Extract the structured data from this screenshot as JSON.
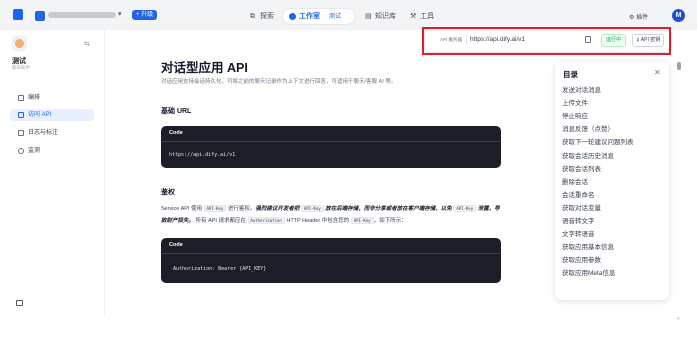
{
  "topbar": {
    "workspace_badge": "+ 升级",
    "nav": [
      {
        "label": "探索"
      },
      {
        "label": "工作室",
        "app": "测试"
      },
      {
        "label": "知识库"
      },
      {
        "label": "工具"
      }
    ],
    "plugins_label": "插件",
    "user_initial": "M"
  },
  "sidebar": {
    "app_name": "测试",
    "app_type": "聊天助手",
    "items": [
      {
        "label": "编排",
        "icon": "orchestrate-icon"
      },
      {
        "label": "访问 API",
        "icon": "api-icon",
        "active": true
      },
      {
        "label": "日志与标注",
        "icon": "logs-icon"
      },
      {
        "label": "监测",
        "icon": "monitor-icon"
      }
    ]
  },
  "main": {
    "title": "对话型应用 API",
    "description": "对话应用支持会话持久化，可将之前的聊天记录作为上下文进行回答，可适用于聊天/客服 AI 等。",
    "base_url_heading": "基础 URL",
    "code1_header": "Code",
    "code1_body": "https://api.dify.ai/v1",
    "auth_heading": "鉴权",
    "auth": {
      "t1": "Service API 使用 ",
      "c1": "API-Key",
      "t2": " 进行鉴权。",
      "b1": "强烈建议开发者把 ",
      "c2": "API-Key",
      "b2": " 放在后端存储，而非分享或者放在客户端存储，以免 ",
      "c3": "API-Key",
      "b3": " 泄露，导致财产损失。",
      "t3": " 所有 API 请求都应在 ",
      "c4": "Authorization",
      "t4": " HTTP Header 中包含您的 ",
      "c5": "API-Key",
      "t5": "，如下所示："
    },
    "code2_header": "Code",
    "code2_body": "Authorization: Bearer {API_KEY}"
  },
  "api_bar": {
    "label": "API 服务器",
    "url": "https://api.dify.ai/v1",
    "status": "运行中",
    "key_button": "API 密钥"
  },
  "toc": {
    "title": "目录",
    "items": [
      "发送对话消息",
      "上传文件",
      "停止响应",
      "消息反馈（点赞）",
      "获取下一轮建议问题列表",
      "获取会话历史消息",
      "获取会话列表",
      "删除会话",
      "会话重命名",
      "获取对话变量",
      "语音转文字",
      "文字转语音",
      "获取应用基本信息",
      "获取应用参数",
      "获取应用Meta信息"
    ]
  },
  "colors": {
    "accent": "#1c64f2",
    "highlight": "#e11d2b",
    "status_green": "#16a34a",
    "code_bg": "#1b1e26"
  }
}
